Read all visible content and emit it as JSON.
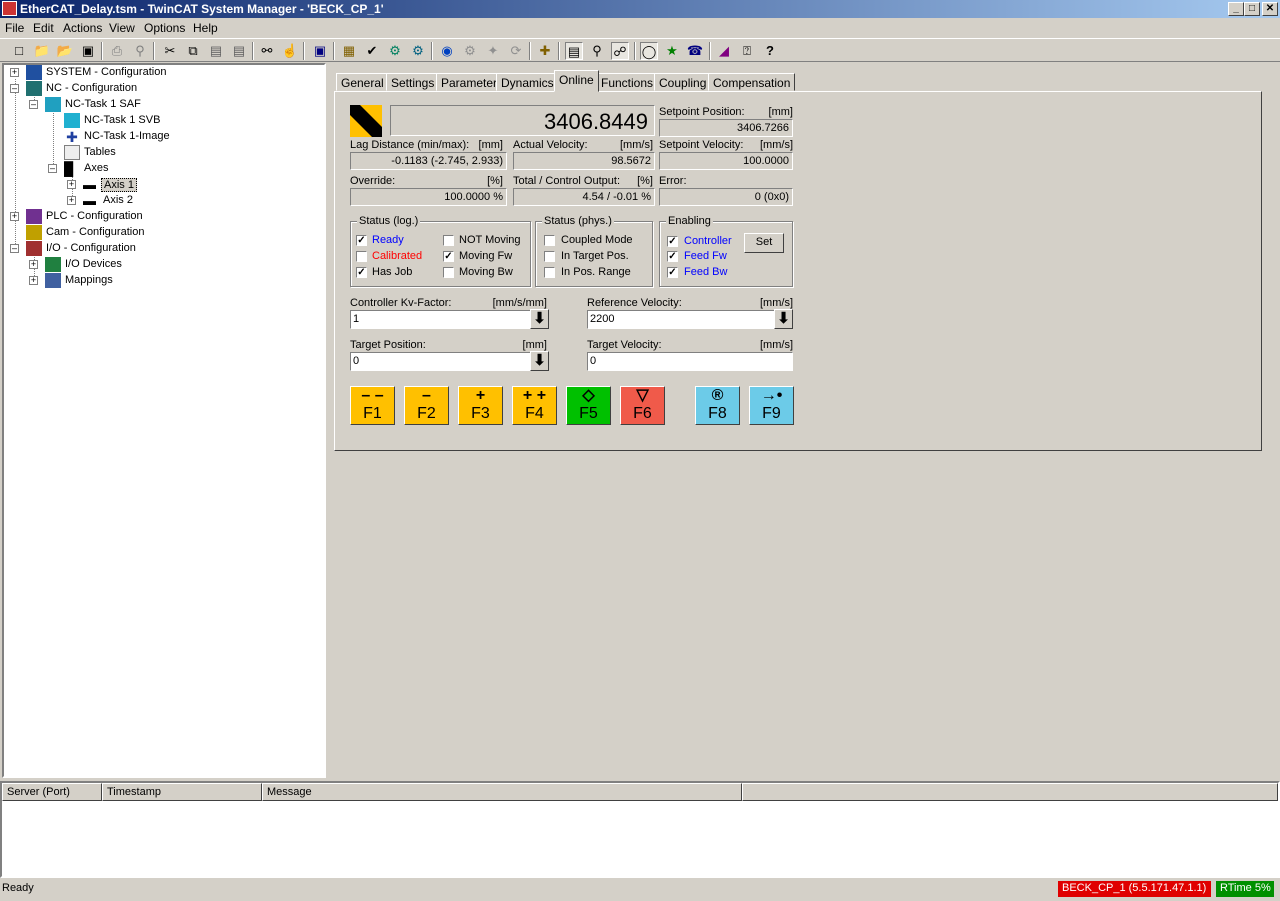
{
  "window": {
    "title": "EtherCAT_Delay.tsm - TwinCAT System Manager - 'BECK_CP_1'",
    "controls": {
      "minimize": "_",
      "restore": "□",
      "close": "✕"
    }
  },
  "menu": [
    "File",
    "Edit",
    "Actions",
    "View",
    "Options",
    "Help"
  ],
  "tree": {
    "system": "SYSTEM - Configuration",
    "nc": "NC - Configuration",
    "nc_task": "NC-Task 1 SAF",
    "nc_task_svb": "NC-Task 1 SVB",
    "nc_task_image": "NC-Task 1-Image",
    "tables": "Tables",
    "axes": "Axes",
    "axis1": "Axis 1",
    "axis2": "Axis 2",
    "plc": "PLC - Configuration",
    "cam": "Cam - Configuration",
    "io": "I/O - Configuration",
    "io_devices": "I/O Devices",
    "mappings": "Mappings"
  },
  "tabs": [
    "General",
    "Settings",
    "Parameter",
    "Dynamics",
    "Online",
    "Functions",
    "Coupling",
    "Compensation"
  ],
  "active_tab": "Online",
  "online": {
    "actual_position": "3406.8449",
    "setpoint_position": {
      "label": "Setpoint Position:",
      "unit": "[mm]",
      "value": "3406.7266"
    },
    "lag_distance": {
      "label": "Lag Distance (min/max):",
      "unit": "[mm]",
      "value": "-0.1183  (-2.745, 2.933)"
    },
    "actual_velocity": {
      "label": "Actual Velocity:",
      "unit": "[mm/s]",
      "value": "98.5672"
    },
    "setpoint_velocity": {
      "label": "Setpoint Velocity:",
      "unit": "[mm/s]",
      "value": "100.0000"
    },
    "override": {
      "label": "Override:",
      "unit": "[%]",
      "value": "100.0000 %"
    },
    "control_output": {
      "label": "Total / Control Output:",
      "unit": "[%]",
      "value": "4.54 / -0.01 %"
    },
    "error": {
      "label": "Error:",
      "value": "0 (0x0)"
    },
    "status_log": {
      "title": "Status (log.)",
      "ready": "Ready",
      "calibrated": "Calibrated",
      "has_job": "Has Job",
      "not_moving": "NOT Moving",
      "moving_fw": "Moving Fw",
      "moving_bw": "Moving Bw"
    },
    "status_phys": {
      "title": "Status (phys.)",
      "coupled_mode": "Coupled Mode",
      "in_target_pos": "In Target Pos.",
      "in_pos_range": "In Pos. Range"
    },
    "enabling": {
      "title": "Enabling",
      "controller": "Controller",
      "feed_fw": "Feed Fw",
      "feed_bw": "Feed Bw",
      "set_label": "Set"
    },
    "kv_factor": {
      "label": "Controller Kv-Factor:",
      "unit": "[mm/s/mm]",
      "value": "1"
    },
    "reference_velocity": {
      "label": "Reference Velocity:",
      "unit": "[mm/s]",
      "value": "2200"
    },
    "target_position": {
      "label": "Target Position:",
      "unit": "[mm]",
      "value": "0"
    },
    "target_velocity": {
      "label": "Target Velocity:",
      "unit": "[mm/s]",
      "value": "0"
    },
    "check": "✓",
    "arrow": "⬇"
  },
  "fkeys": [
    {
      "sym": "– –",
      "label": "F1",
      "color": "#ffc000"
    },
    {
      "sym": "–",
      "label": "F2",
      "color": "#ffc000"
    },
    {
      "sym": "+",
      "label": "F3",
      "color": "#ffc000"
    },
    {
      "sym": "+ +",
      "label": "F4",
      "color": "#ffc000"
    },
    {
      "sym": "◇",
      "label": "F5",
      "color": "#00c000"
    },
    {
      "sym": "▽",
      "label": "F6",
      "color": "#f05a4a"
    },
    {
      "sym": "®",
      "label": "F8",
      "color": "#6ccbe8"
    },
    {
      "sym": "→•",
      "label": "F9",
      "color": "#6ccbe8"
    }
  ],
  "messages": {
    "columns": [
      "Server (Port)",
      "Timestamp",
      "Message"
    ]
  },
  "statusbar": {
    "text": "Ready",
    "target": "BECK_CP_1 (5.5.171.47.1.1)",
    "rtime": "RTime 5%",
    "colors": {
      "target_bg": "#e00000",
      "rtime_bg": "#009000"
    }
  },
  "toolbar_icons": [
    "new-icon",
    "open-icon",
    "open-folder-icon",
    "save-icon",
    "print-icon",
    "print-preview-icon",
    "cut-icon",
    "copy-icon",
    "paste-icon",
    "paste-with-links-icon",
    "find-icon",
    "find-next-icon",
    "save-to-target-icon",
    "generate-mappings-icon",
    "check-configuration-icon",
    "activate-configuration-icon",
    "set-run-mode-icon",
    "restart-icon",
    "reload-icon",
    "scan-devices-icon",
    "free-run-icon",
    "add-item-icon",
    "show-online-data-icon",
    "zoom-icon",
    "choose-target-icon",
    "toggle-freerun-icon",
    "show-sub-items-icon",
    "quick-help-icon",
    "manual-icon",
    "about-icon",
    "help-icon"
  ]
}
